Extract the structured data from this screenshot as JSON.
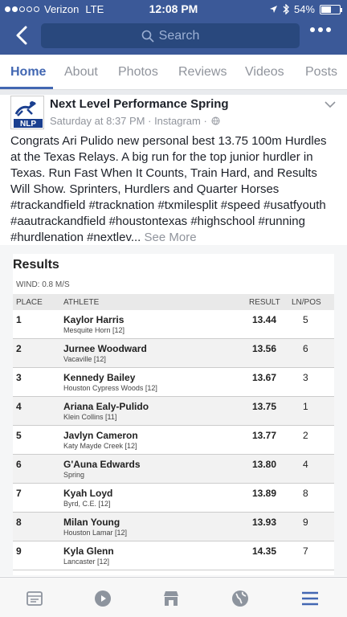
{
  "status_bar": {
    "carrier": "Verizon",
    "network": "LTE",
    "time": "12:08 PM",
    "battery": "54%"
  },
  "search": {
    "placeholder": "Search"
  },
  "tabs": [
    "Home",
    "About",
    "Photos",
    "Reviews",
    "Videos",
    "Posts"
  ],
  "post": {
    "page_name": "Next Level Performance Spring",
    "meta": "Saturday at 8:37 PM · Instagram ·",
    "avatar_text": "NLP",
    "text": "Congrats Ari Pulido new personal best 13.75 100m Hurdles at the Texas Relays. A big run for the top junior hurdler in Texas. Run Fast When It Counts, Train Hard, and Results Will Show. Sprinters, Hurdlers  and Quarter Horses #trackandfield  #tracknation #txmilesplit #speed #usatfyouth #aautrackandfield #houstontexas #highschool #running #hurdlenation #nextlev...",
    "see_more": "See More"
  },
  "results": {
    "title": "Results",
    "wind": "WIND: 0.8 M/S",
    "headers": {
      "place": "PLACE",
      "athlete": "ATHLETE",
      "result": "RESULT",
      "pos": "LN/POS"
    },
    "rows": [
      {
        "place": "1",
        "name": "Kaylor Harris",
        "school": "Mesquite Horn [12]",
        "result": "13.44",
        "pos": "5"
      },
      {
        "place": "2",
        "name": "Jurnee Woodward",
        "school": "Vacaville [12]",
        "result": "13.56",
        "pos": "6"
      },
      {
        "place": "3",
        "name": "Kennedy Bailey",
        "school": "Houston Cypress Woods [12]",
        "result": "13.67",
        "pos": "3"
      },
      {
        "place": "4",
        "name": "Ariana Ealy-Pulido",
        "school": "Klein Collins [11]",
        "result": "13.75",
        "pos": "1"
      },
      {
        "place": "5",
        "name": "Javlyn Cameron",
        "school": "Katy Mayde Creek [12]",
        "result": "13.77",
        "pos": "2"
      },
      {
        "place": "6",
        "name": "G'Auna Edwards",
        "school": "Spring",
        "result": "13.80",
        "pos": "4"
      },
      {
        "place": "7",
        "name": "Kyah Loyd",
        "school": "Byrd, C.E. [12]",
        "result": "13.89",
        "pos": "8"
      },
      {
        "place": "8",
        "name": "Milan Young",
        "school": "Houston Lamar [12]",
        "result": "13.93",
        "pos": "9"
      },
      {
        "place": "9",
        "name": "Kyla Glenn",
        "school": "Lancaster [12]",
        "result": "14.35",
        "pos": "7"
      }
    ]
  },
  "bottom_bar": [
    "news-feed-icon",
    "video-icon",
    "marketplace-icon",
    "globe-icon",
    "menu-icon"
  ],
  "colors": {
    "brand": "#3b5998",
    "accent": "#4267b2",
    "active_menu": "#4267b2"
  }
}
